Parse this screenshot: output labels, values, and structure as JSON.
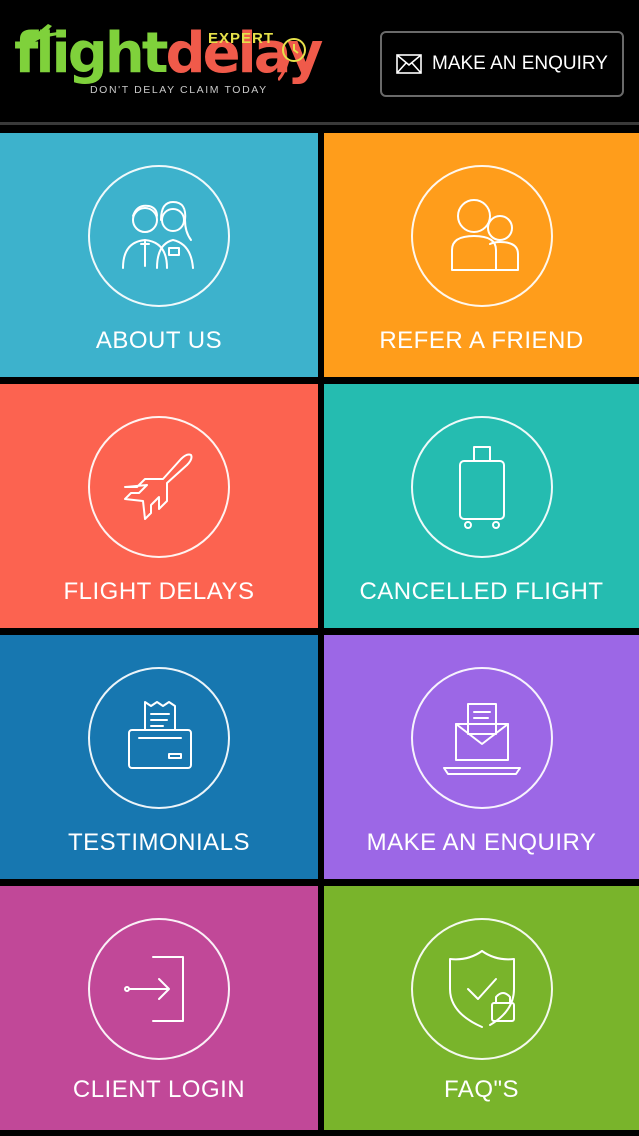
{
  "header": {
    "logo": {
      "word_part1": "flight",
      "word_part2": "delay",
      "badge": "EXPERT",
      "tagline": "DON'T DELAY CLAIM TODAY"
    },
    "enquiry_button": {
      "label": "MAKE AN ENQUIRY",
      "icon": "envelope-icon"
    }
  },
  "tiles": [
    {
      "label": "ABOUT US",
      "icon": "people-icon",
      "color": "#3db2cc"
    },
    {
      "label": "REFER A FRIEND",
      "icon": "users-icon",
      "color": "#ff9d1b"
    },
    {
      "label": "FLIGHT DELAYS",
      "icon": "airplane-icon",
      "color": "#fc6350"
    },
    {
      "label": "CANCELLED FLIGHT",
      "icon": "suitcase-icon",
      "color": "#25bcb0"
    },
    {
      "label": "TESTIMONIALS",
      "icon": "printer-icon",
      "color": "#1777b0"
    },
    {
      "label": "MAKE AN ENQUIRY",
      "icon": "mail-laptop-icon",
      "color": "#9c67e6"
    },
    {
      "label": "CLIENT LOGIN",
      "icon": "login-icon",
      "color": "#c14898"
    },
    {
      "label": "FAQ\"S",
      "icon": "shield-lock-icon",
      "color": "#79b42b"
    }
  ]
}
